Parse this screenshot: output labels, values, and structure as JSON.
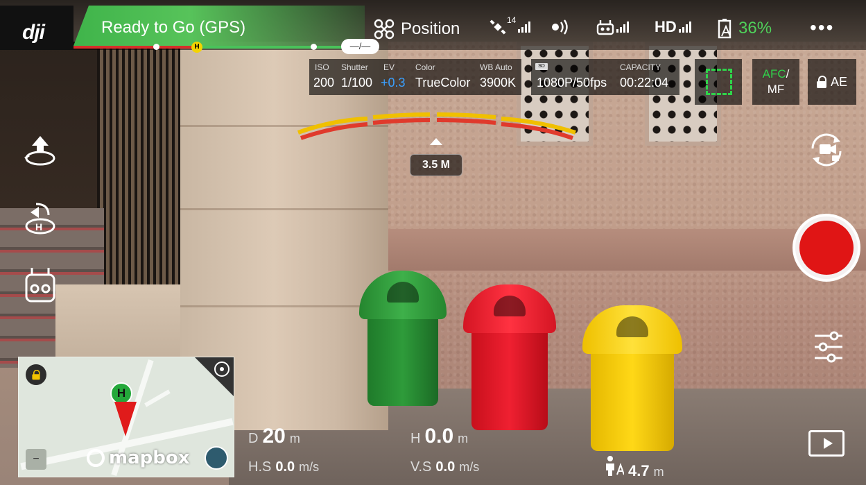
{
  "app": {
    "logo": "dji"
  },
  "status": {
    "text": "Ready to Go (GPS)",
    "distance_pill": "—/—"
  },
  "topbar": {
    "flight_mode": "Position",
    "gps_satellites": "14",
    "remote_label": "",
    "hd_label": "HD",
    "battery_percent": "36%",
    "colors": {
      "status_green": "#57c35a",
      "battery_green": "#4fd15a"
    }
  },
  "camera": {
    "iso_label": "ISO",
    "iso_value": "200",
    "shutter_label": "Shutter",
    "shutter_value": "1/100",
    "ev_label": "EV",
    "ev_value": "+0.3",
    "color_label": "Color",
    "color_value": "TrueColor",
    "wb_label": "WB Auto",
    "wb_value": "3900K",
    "sd_label": "SD",
    "capacity_label": "CAPACITY",
    "resolution_value": "1080P/50fps",
    "capacity_value": "00:22:04",
    "focus_mode_primary": "AFC",
    "focus_mode_sep": "/",
    "focus_mode_secondary": "MF",
    "ae_label": "AE"
  },
  "obstacle": {
    "distance": "3.5 M"
  },
  "telemetry": {
    "d_label": "D",
    "d_value": "20",
    "d_unit": "m",
    "h_label": "H",
    "h_value": "0.0",
    "h_unit": "m",
    "hs_label": "H.S",
    "hs_value": "0.0",
    "hs_unit": "m/s",
    "vs_label": "V.S",
    "vs_value": "0.0",
    "vs_unit": "m/s",
    "vps_value": "4.7",
    "vps_unit": "m"
  },
  "map": {
    "home_label": "H",
    "brand": "mapbox"
  },
  "icons": [
    "dji-logo",
    "aircraft-icon",
    "gps-icon",
    "vision-icon",
    "remote-icon",
    "hd-signal-icon",
    "battery-icon",
    "more-icon",
    "takeoff-icon",
    "return-home-icon",
    "remote-controller-icon",
    "camera-switch-icon",
    "record-button",
    "settings-sliders-icon",
    "playback-icon",
    "map-lock-icon",
    "map-target-icon",
    "zoom-out-icon",
    "compass-icon",
    "person-altitude-icon"
  ]
}
